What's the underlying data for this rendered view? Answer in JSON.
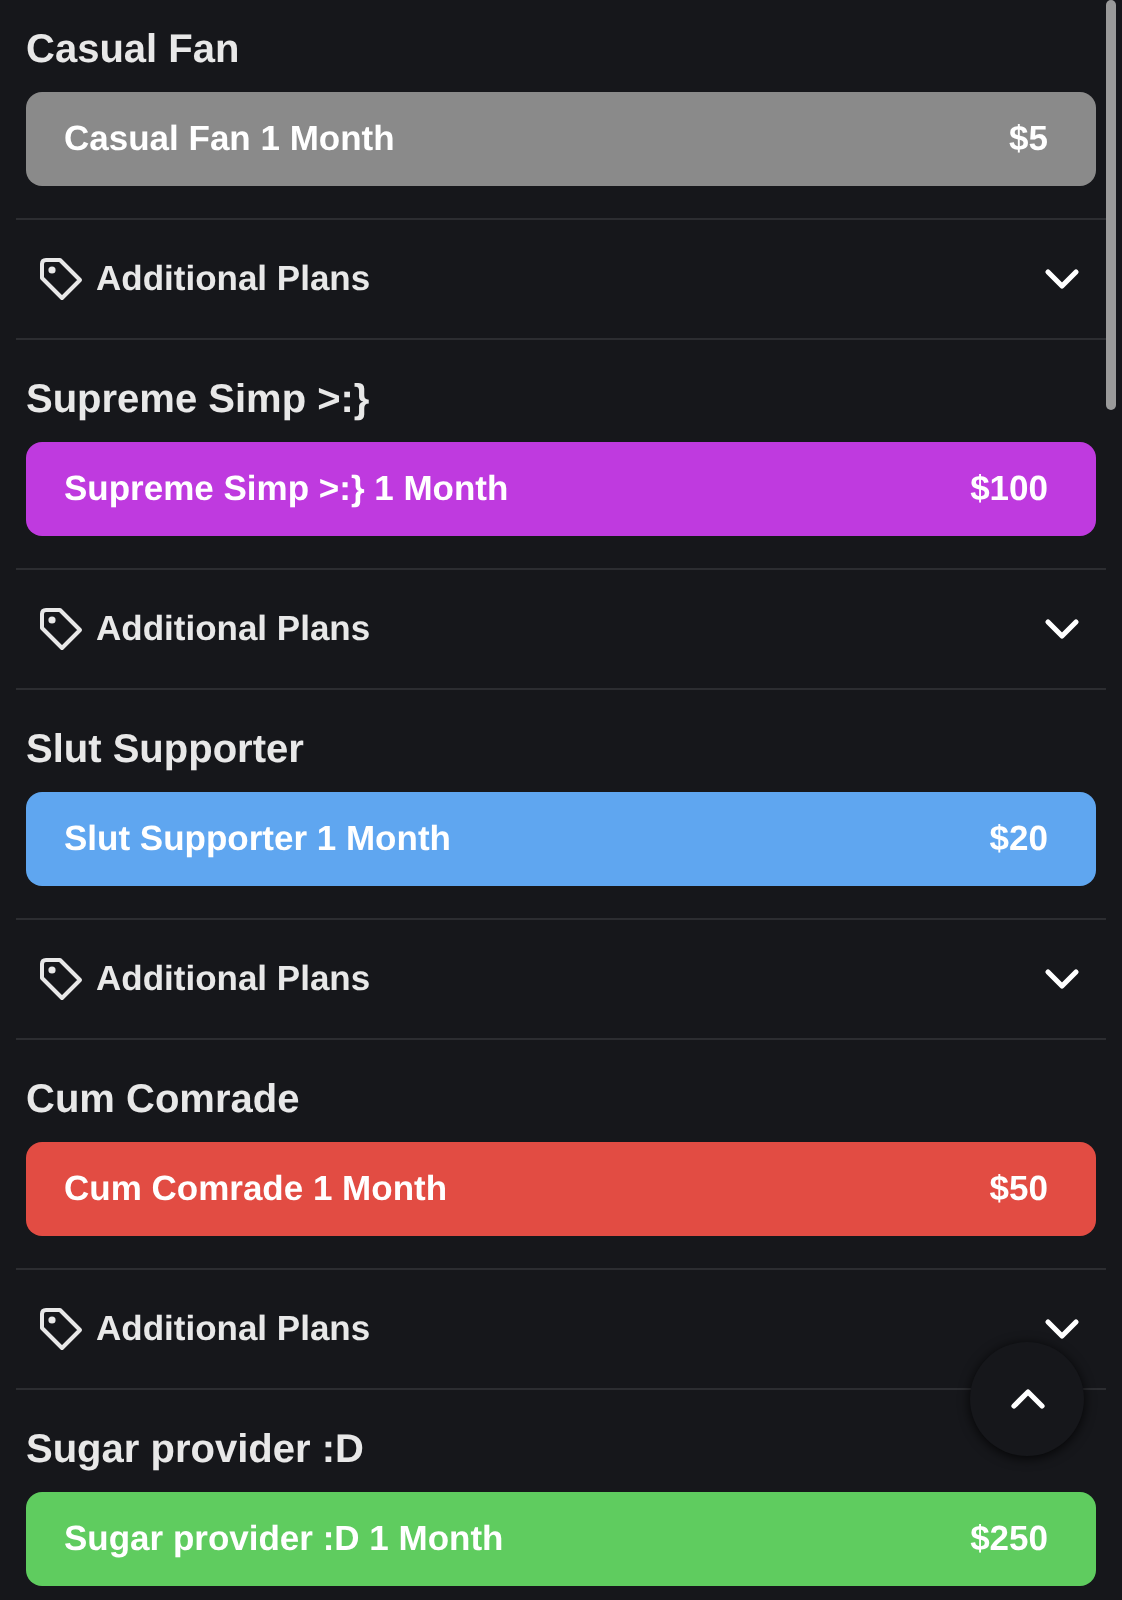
{
  "tiers": [
    {
      "title": "Casual Fan",
      "plan": {
        "label": "Casual Fan 1 Month",
        "price": "$5",
        "color": "#8a8a8a"
      },
      "additional": {
        "label": "Additional Plans",
        "expanded": false
      }
    },
    {
      "title": "Supreme Simp >:}",
      "plan": {
        "label": "Supreme Simp >:} 1 Month",
        "price": "$100",
        "color": "#bf3adf"
      },
      "additional": {
        "label": "Additional Plans",
        "expanded": false
      }
    },
    {
      "title": "Slut Supporter",
      "plan": {
        "label": "Slut Supporter 1 Month",
        "price": "$20",
        "color": "#5fa6f0"
      },
      "additional": {
        "label": "Additional Plans",
        "expanded": false
      }
    },
    {
      "title": "Cum Comrade",
      "plan": {
        "label": "Cum Comrade 1 Month",
        "price": "$50",
        "color": "#e24c43"
      },
      "additional": {
        "label": "Additional Plans",
        "expanded": false
      }
    },
    {
      "title": "Sugar provider :D",
      "plan": {
        "label": "Sugar provider :D 1 Month",
        "price": "$250",
        "color": "#5fcc5f"
      }
    }
  ]
}
